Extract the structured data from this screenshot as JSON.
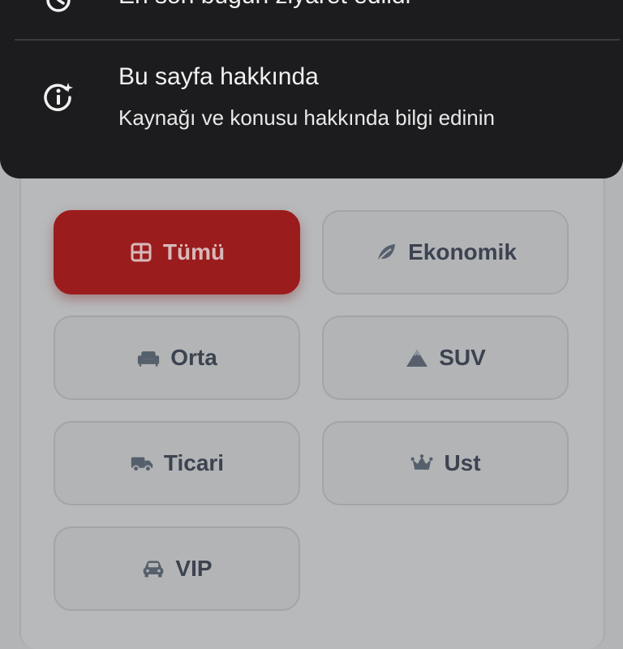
{
  "menu": {
    "items": [
      {
        "title": "En son bugün ziyaret edildi",
        "subtitle": "",
        "icon": "history-icon"
      },
      {
        "title": "Bu sayfa hakkında",
        "subtitle": "Kaynağı ve konusu hakkında bilgi edinin",
        "icon": "info-sparkle-icon"
      }
    ]
  },
  "categories": {
    "active": "Tümü",
    "items": [
      {
        "label": "Tümü",
        "icon": "grid-icon"
      },
      {
        "label": "Ekonomik",
        "icon": "leaf-icon"
      },
      {
        "label": "Orta",
        "icon": "sofa-icon"
      },
      {
        "label": "SUV",
        "icon": "mountain-icon"
      },
      {
        "label": "Ticari",
        "icon": "truck-icon"
      },
      {
        "label": "Ust",
        "icon": "crown-icon"
      },
      {
        "label": "VIP",
        "icon": "car-icon"
      }
    ]
  },
  "colors": {
    "active_bg": "#9b1c1c",
    "sheet_bg": "#1c1c1e",
    "scrim_bg": "#b3b4b6"
  }
}
